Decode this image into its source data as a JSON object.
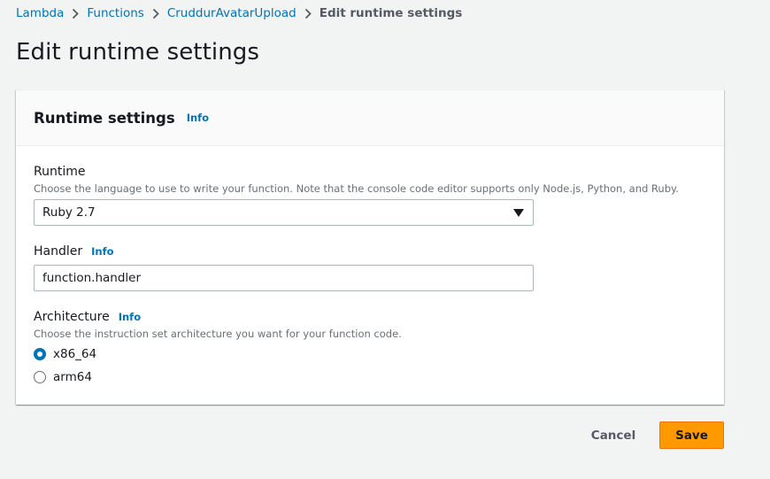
{
  "breadcrumb": {
    "items": [
      "Lambda",
      "Functions",
      "CruddurAvatarUpload"
    ],
    "current": "Edit runtime settings"
  },
  "page_title": "Edit runtime settings",
  "panel": {
    "title": "Runtime settings",
    "info_label": "Info",
    "runtime": {
      "label": "Runtime",
      "description": "Choose the language to use to write your function. Note that the console code editor supports only Node.js, Python, and Ruby.",
      "selected": "Ruby 2.7"
    },
    "handler": {
      "label": "Handler",
      "info_label": "Info",
      "value": "function.handler"
    },
    "architecture": {
      "label": "Architecture",
      "info_label": "Info",
      "description": "Choose the instruction set architecture you want for your function code.",
      "options": [
        {
          "label": "x86_64",
          "checked": true
        },
        {
          "label": "arm64",
          "checked": false
        }
      ]
    }
  },
  "actions": {
    "cancel_label": "Cancel",
    "save_label": "Save"
  },
  "colors": {
    "link": "#0073bb",
    "primary": "#ff9900",
    "background": "#f2f3f3"
  },
  "icons": {
    "breadcrumb_separator": "chevron-right-icon",
    "select_caret": "caret-down-icon"
  }
}
